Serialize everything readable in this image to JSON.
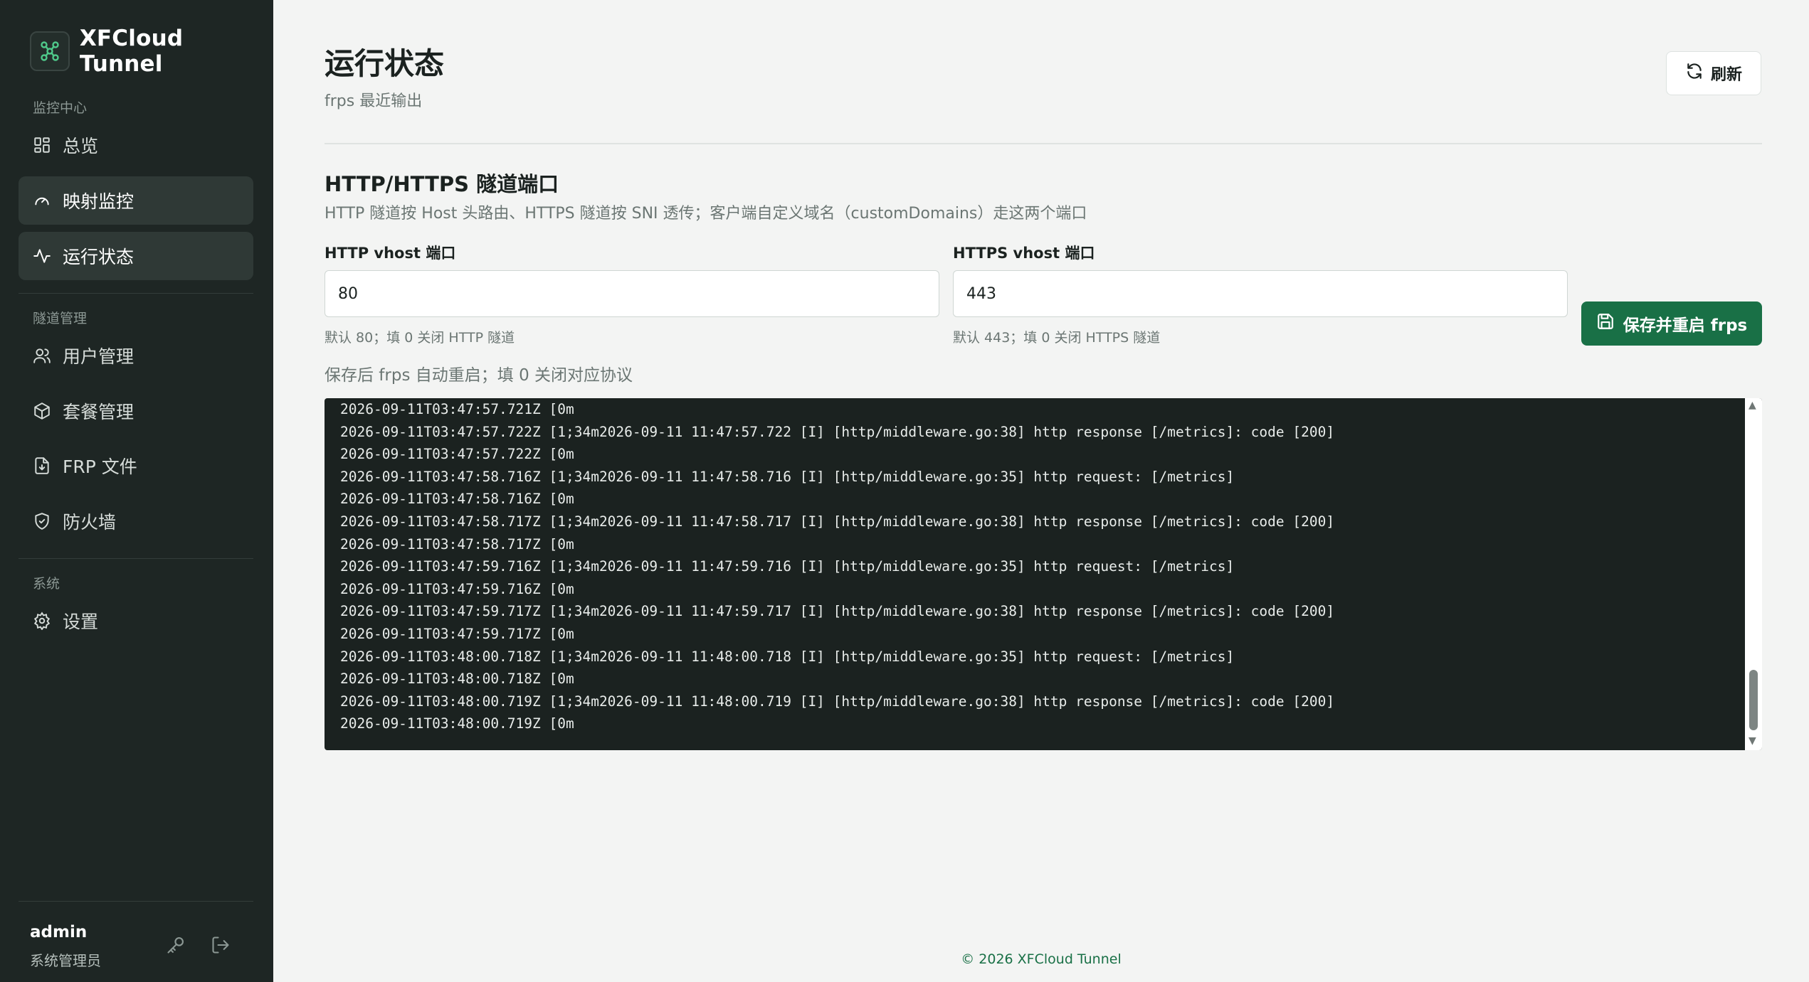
{
  "brand": {
    "name": "XFCloud Tunnel"
  },
  "sidebar": {
    "sections": [
      {
        "label": "监控中心"
      },
      {
        "label": "隧道管理"
      },
      {
        "label": "系统"
      }
    ],
    "items": [
      {
        "label": "总览",
        "icon": "grid-icon",
        "active": false
      },
      {
        "label": "映射监控",
        "icon": "gauge-icon",
        "active": true
      },
      {
        "label": "运行状态",
        "icon": "activity-icon",
        "active": true
      },
      {
        "label": "用户管理",
        "icon": "users-icon",
        "active": false
      },
      {
        "label": "套餐管理",
        "icon": "package-icon",
        "active": false
      },
      {
        "label": "FRP 文件",
        "icon": "file-download-icon",
        "active": false
      },
      {
        "label": "防火墙",
        "icon": "shield-check-icon",
        "active": false
      },
      {
        "label": "设置",
        "icon": "gear-icon",
        "active": false
      }
    ],
    "user": {
      "name": "admin",
      "role": "系统管理员"
    }
  },
  "header": {
    "title": "运行状态",
    "subtitle": "frps 最近输出",
    "refresh_label": "刷新"
  },
  "ports": {
    "title": "HTTP/HTTPS 隧道端口",
    "description": "HTTP 隧道按 Host 头路由、HTTPS 隧道按 SNI 透传；客户端自定义域名（customDomains）走这两个端口",
    "http": {
      "label": "HTTP vhost 端口",
      "value": "80",
      "hint": "默认 80；填 0 关闭 HTTP 隧道"
    },
    "https": {
      "label": "HTTPS vhost 端口",
      "value": "443",
      "hint": "默认 443；填 0 关闭 HTTPS 隧道"
    },
    "save_label": "保存并重启 frps",
    "note": "保存后 frps 自动重启；填 0 关闭对应协议"
  },
  "log": {
    "lines": [
      "2026-09-11T03:47:57.721Z \u001b[0m",
      "2026-09-11T03:47:57.722Z \u001b[1;34m2026-09-11 11:47:57.722 [I] [http/middleware.go:38] http response [/metrics]: code [200]",
      "2026-09-11T03:47:57.722Z \u001b[0m",
      "2026-09-11T03:47:58.716Z \u001b[1;34m2026-09-11 11:47:58.716 [I] [http/middleware.go:35] http request: [/metrics]",
      "2026-09-11T03:47:58.716Z \u001b[0m",
      "2026-09-11T03:47:58.717Z \u001b[1;34m2026-09-11 11:47:58.717 [I] [http/middleware.go:38] http response [/metrics]: code [200]",
      "2026-09-11T03:47:58.717Z \u001b[0m",
      "2026-09-11T03:47:59.716Z \u001b[1;34m2026-09-11 11:47:59.716 [I] [http/middleware.go:35] http request: [/metrics]",
      "2026-09-11T03:47:59.716Z \u001b[0m",
      "2026-09-11T03:47:59.717Z \u001b[1;34m2026-09-11 11:47:59.717 [I] [http/middleware.go:38] http response [/metrics]: code [200]",
      "2026-09-11T03:47:59.717Z \u001b[0m",
      "2026-09-11T03:48:00.718Z \u001b[1;34m2026-09-11 11:48:00.718 [I] [http/middleware.go:35] http request: [/metrics]",
      "2026-09-11T03:48:00.718Z \u001b[0m",
      "2026-09-11T03:48:00.719Z \u001b[1;34m2026-09-11 11:48:00.719 [I] [http/middleware.go:38] http response [/metrics]: code [200]",
      "2026-09-11T03:48:00.719Z \u001b[0m"
    ]
  },
  "footer": {
    "text": "© 2026 XFCloud Tunnel"
  },
  "colors": {
    "sidebar_bg": "#1e2624",
    "accent": "#197046",
    "log_bg": "#1b2220",
    "page_bg": "#f3f4f3"
  }
}
